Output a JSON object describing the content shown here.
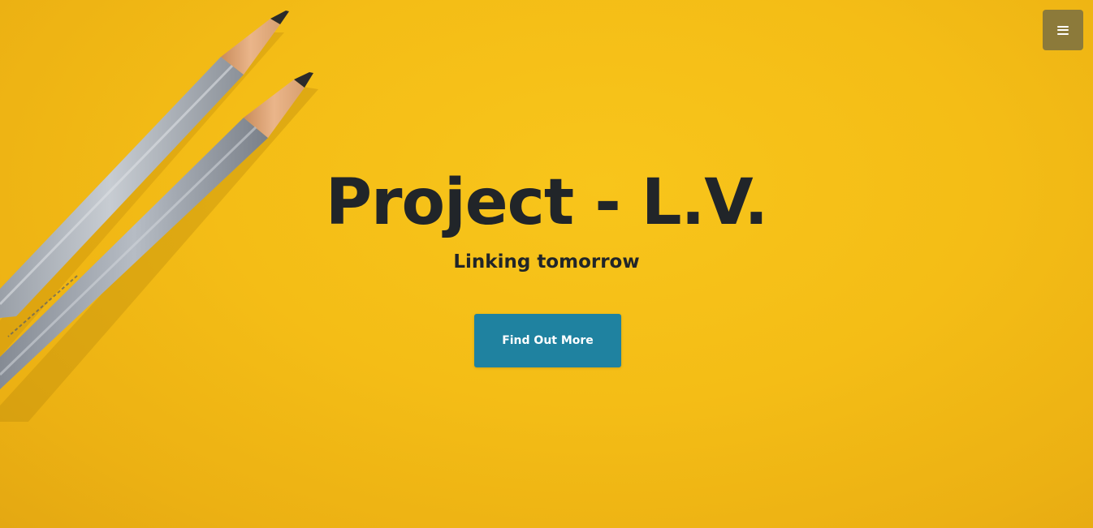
{
  "hero": {
    "title": "Project - L.V.",
    "subtitle": "Linking tomorrow",
    "cta_label": "Find Out More",
    "background_color": "#f6c018",
    "background_image": "pencils-on-yellow-paper"
  },
  "nav": {
    "menu_icon": "hamburger-menu-icon",
    "menu_button_color": "#8c7a3a"
  },
  "colors": {
    "text": "#212529",
    "button": "#1f82a0",
    "button_text": "#ffffff"
  }
}
